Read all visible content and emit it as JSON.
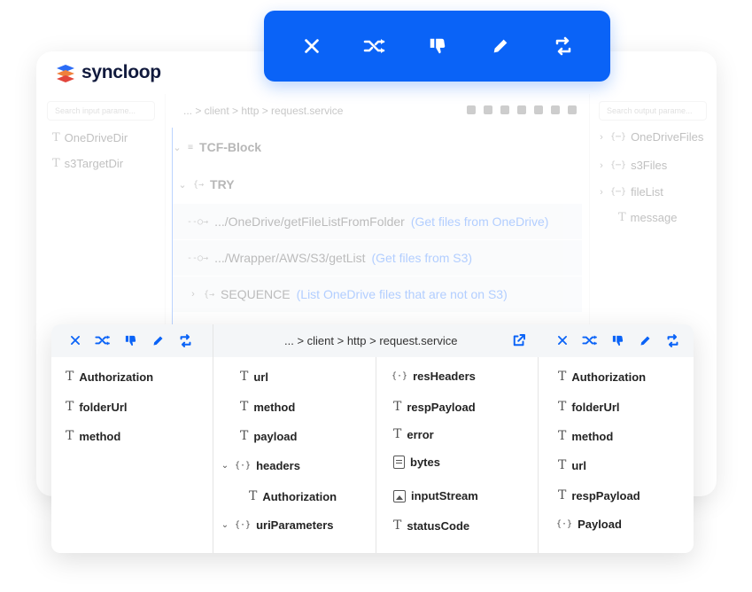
{
  "colors": {
    "accent": "#0a63f7",
    "accent_text": "#4a8cff",
    "logo_dark": "#111a3d"
  },
  "app": {
    "logo_text": "syncloop"
  },
  "toolbar": {
    "buttons": [
      {
        "name": "close-icon",
        "label": "Close"
      },
      {
        "name": "shuffle-icon",
        "label": "Shuffle"
      },
      {
        "name": "thumbs-down-icon",
        "label": "Drop"
      },
      {
        "name": "pencil-icon",
        "label": "Edit"
      },
      {
        "name": "repeat-icon",
        "label": "Loop"
      }
    ]
  },
  "background": {
    "left_search_placeholder": "Search input parame...",
    "left_vars": [
      "OneDriveDir",
      "s3TargetDir"
    ],
    "breadcrumb": "... > client > http > request.service",
    "flow": [
      {
        "label": "TCF-Block",
        "desc": ""
      },
      {
        "label": "TRY",
        "desc": ""
      },
      {
        "label": ".../OneDrive/getFileListFromFolder",
        "desc": "(Get files from OneDrive)"
      },
      {
        "label": ".../Wrapper/AWS/S3/getList",
        "desc": "(Get files from S3)"
      },
      {
        "label": "SEQUENCE",
        "desc": "(List OneDrive files that are not on S3)"
      }
    ],
    "right_search_placeholder": "Search output parame...",
    "right_vars": [
      "OneDriveFiles",
      "s3Files",
      "fileList",
      "message"
    ]
  },
  "mapping": {
    "breadcrumb": "... > client > http > request.service",
    "col_a": [
      "Authorization",
      "folderUrl",
      "method"
    ],
    "col_b": [
      "url",
      "method",
      "payload",
      "headers",
      "Authorization",
      "uriParameters"
    ],
    "col_c": [
      "resHeaders",
      "respPayload",
      "error",
      "bytes",
      "inputStream",
      "statusCode"
    ],
    "col_d": [
      "Authorization",
      "folderUrl",
      "method",
      "url",
      "respPayload",
      "Payload"
    ]
  }
}
